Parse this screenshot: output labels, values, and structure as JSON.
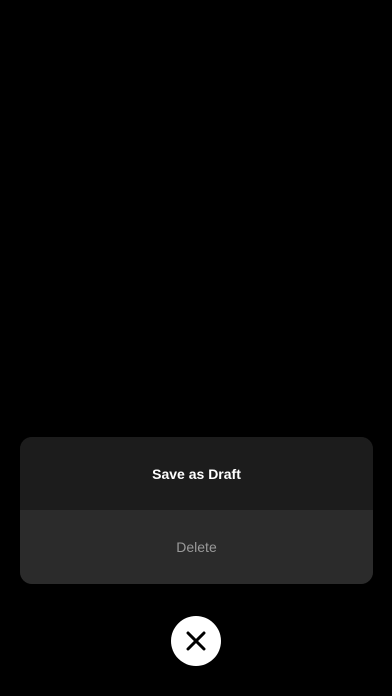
{
  "action_sheet": {
    "save_draft_label": "Save as Draft",
    "delete_label": "Delete"
  },
  "close_button": {
    "icon": "close-icon"
  },
  "colors": {
    "background": "#000000",
    "sheet_primary": "#1c1c1c",
    "sheet_secondary": "#2b2b2b",
    "primary_text": "#ffffff",
    "secondary_text": "#9a9a9a",
    "close_bg": "#ffffff",
    "close_icon": "#000000"
  }
}
